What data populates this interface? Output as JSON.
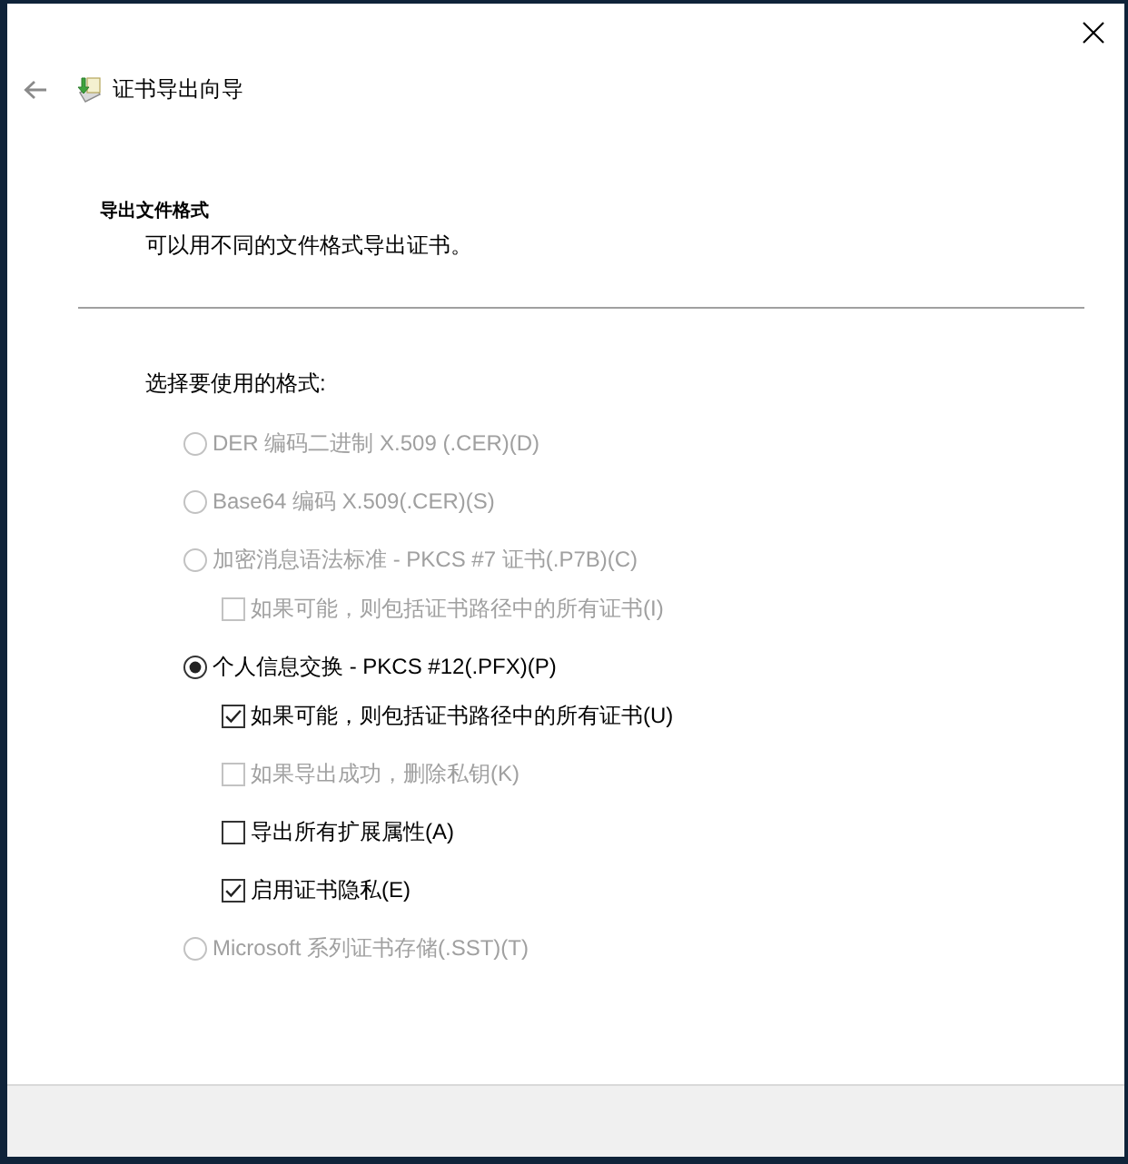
{
  "window": {
    "title": "证书导出向导"
  },
  "header": {
    "title": "导出文件格式",
    "description": "可以用不同的文件格式导出证书。"
  },
  "format_prompt": "选择要使用的格式:",
  "formats": [
    {
      "label": "DER 编码二进制 X.509 (.CER)(D)",
      "selected": false,
      "disabled": true
    },
    {
      "label": "Base64 编码 X.509(.CER)(S)",
      "selected": false,
      "disabled": true
    },
    {
      "label": "加密消息语法标准 - PKCS #7 证书(.P7B)(C)",
      "selected": false,
      "disabled": true,
      "children": [
        {
          "label": "如果可能，则包括证书路径中的所有证书(I)",
          "checked": false,
          "disabled": true
        }
      ]
    },
    {
      "label": "个人信息交换 - PKCS #12(.PFX)(P)",
      "selected": true,
      "disabled": false,
      "children": [
        {
          "label": "如果可能，则包括证书路径中的所有证书(U)",
          "checked": true,
          "disabled": false
        },
        {
          "label": "如果导出成功，删除私钥(K)",
          "checked": false,
          "disabled": true
        },
        {
          "label": "导出所有扩展属性(A)",
          "checked": false,
          "disabled": false
        },
        {
          "label": "启用证书隐私(E)",
          "checked": true,
          "disabled": false
        }
      ]
    },
    {
      "label": "Microsoft 系列证书存储(.SST)(T)",
      "selected": false,
      "disabled": true
    }
  ]
}
